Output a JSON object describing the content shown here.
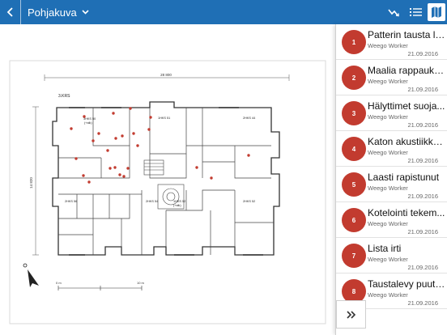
{
  "header": {
    "title": "Pohjakuva",
    "back_icon": "chevron-left-icon",
    "dropdown_icon": "chevron-down-icon",
    "icons": [
      "trend-line-icon",
      "list-icon",
      "map-icon"
    ]
  },
  "colors": {
    "topbar": "#1f6fb5",
    "marker": "#c23b2f"
  },
  "floorplan": {
    "floor_label": "3.KRS",
    "width_dim": "28 800",
    "height_dim": "14 820",
    "scale_start": "0 m",
    "scale_end": "10 m",
    "rooms": [
      {
        "id": "a50",
        "name": "3HKS 50",
        "extra": "(+alk)"
      },
      {
        "id": "a51",
        "name": "1HKS 51"
      },
      {
        "id": "a44",
        "name": "2HKS 44"
      },
      {
        "id": "a56",
        "name": "2HKS 56"
      },
      {
        "id": "a54",
        "name": "2HKS 54"
      },
      {
        "id": "a53",
        "name": "1HKS 52",
        "extra": "(+alk)"
      },
      {
        "id": "a52",
        "name": "2HKS 52"
      }
    ]
  },
  "tasks": [
    {
      "number": "1",
      "title": "Patterin tausta li...",
      "worker": "Weego Worker",
      "date": "21.09.2016"
    },
    {
      "number": "2",
      "title": "Maalia rappauks...",
      "worker": "Weego Worker",
      "date": "21.09.2016"
    },
    {
      "number": "3",
      "title": "Hälyttimet suoja...",
      "worker": "Weego Worker",
      "date": "21.09.2016"
    },
    {
      "number": "4",
      "title": "Katon akustiikka...",
      "worker": "Weego Worker",
      "date": "21.09.2016"
    },
    {
      "number": "5",
      "title": "Laasti rapistunut",
      "worker": "Weego Worker",
      "date": "21.09.2016"
    },
    {
      "number": "6",
      "title": "Kotelointi tekem...",
      "worker": "Weego Worker",
      "date": "21.09.2016"
    },
    {
      "number": "7",
      "title": "Lista irti",
      "worker": "Weego Worker",
      "date": "21.09.2016"
    },
    {
      "number": "8",
      "title": "Taustalevy puutuu",
      "worker": "Weego Worker",
      "date": "21.09.2016"
    }
  ],
  "expand_icon": "double-chevron-right-icon"
}
